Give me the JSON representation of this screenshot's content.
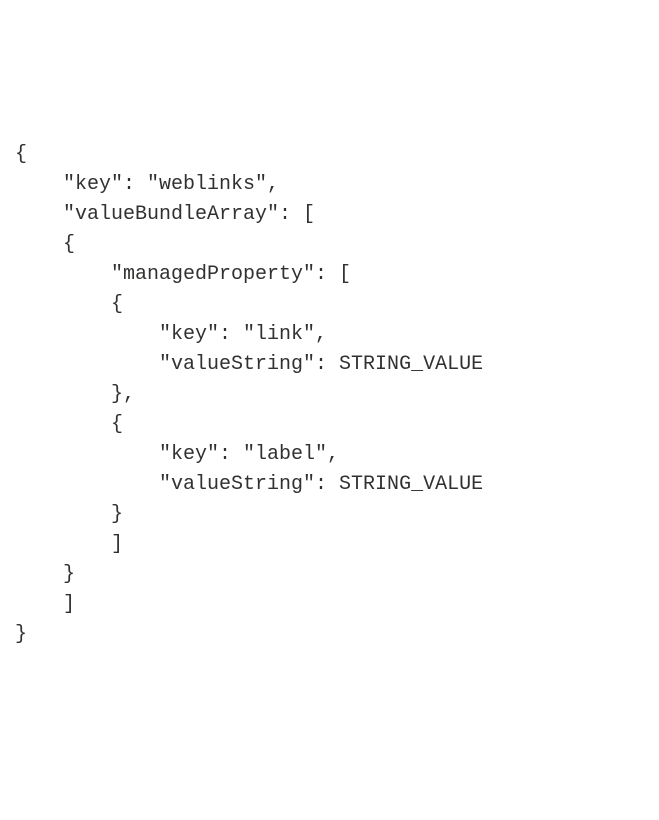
{
  "code": {
    "line1": "{",
    "line2": "    \"key\": \"weblinks\",",
    "line3": "    \"valueBundleArray\": [",
    "line4": "    {",
    "line5": "        \"managedProperty\": [",
    "line6": "        {",
    "line7": "            \"key\": \"link\",",
    "line8": "            \"valueString\": STRING_VALUE",
    "line9": "        },",
    "line10": "        {",
    "line11": "            \"key\": \"label\",",
    "line12": "            \"valueString\": STRING_VALUE",
    "line13": "        }",
    "line14": "        ]",
    "line15": "    }",
    "line16": "    ]",
    "line17": "}"
  }
}
